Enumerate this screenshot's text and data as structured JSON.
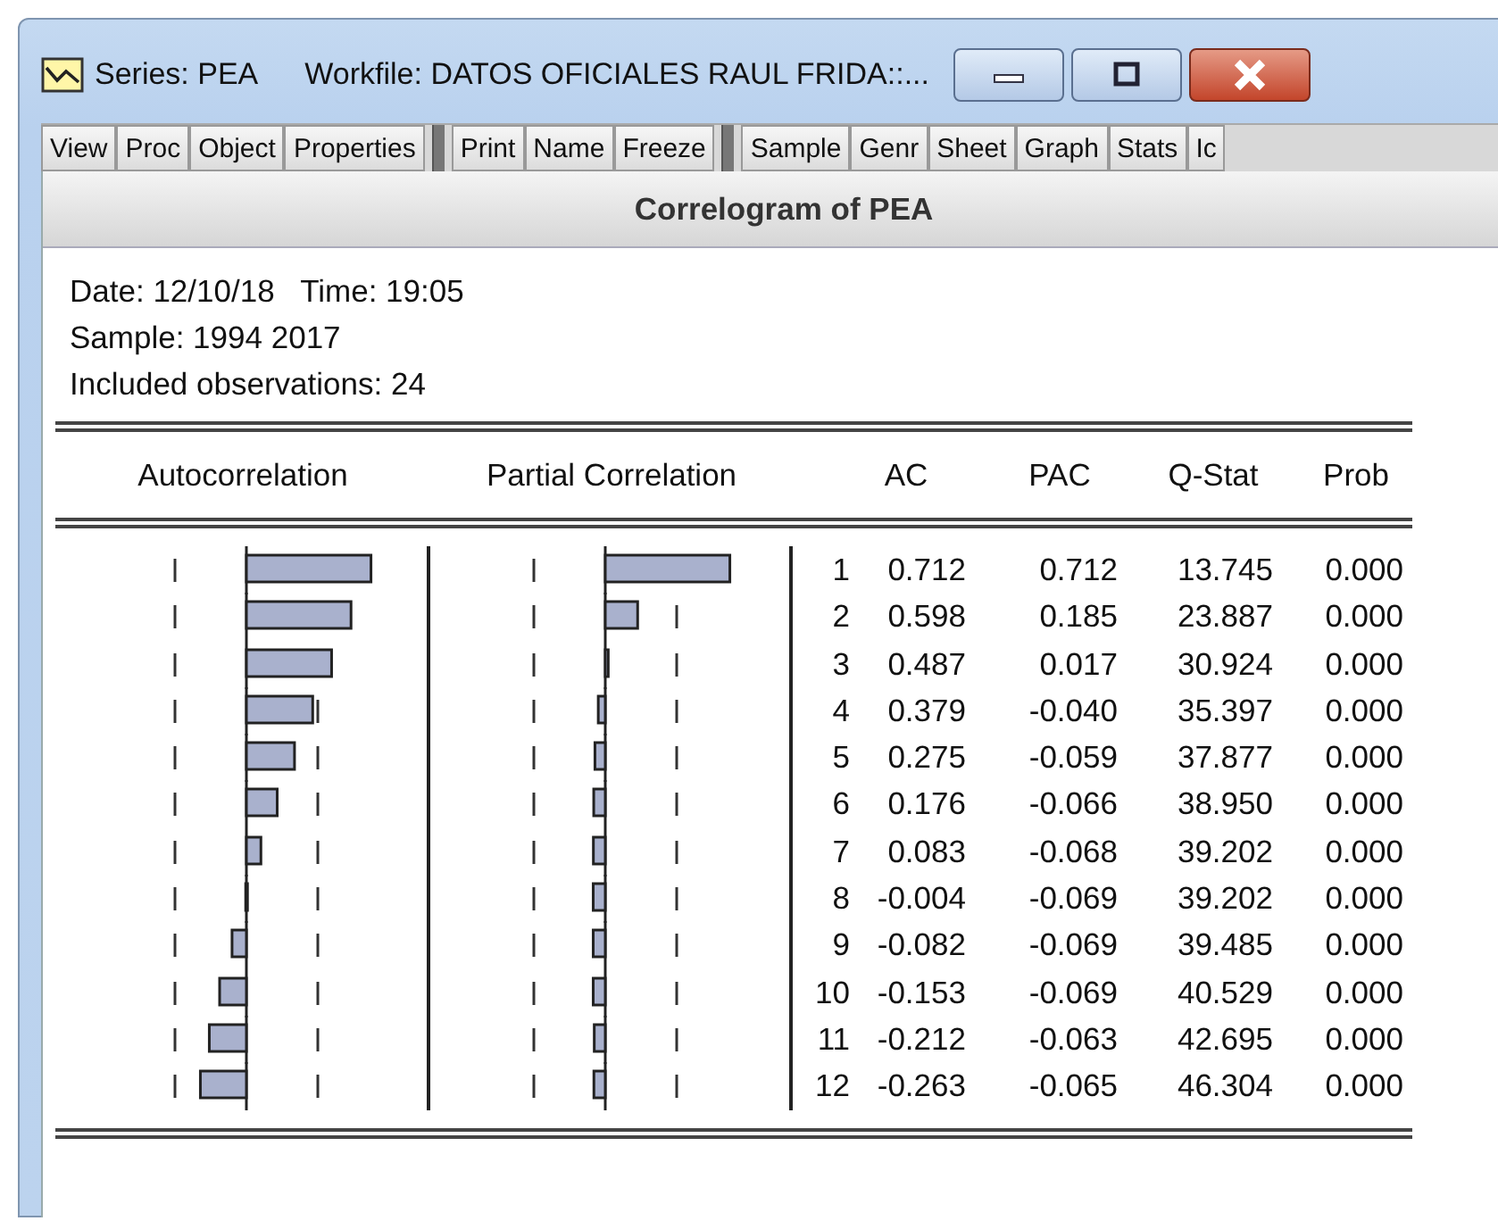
{
  "window": {
    "series_title": "Series: PEA",
    "workfile_title": "Workfile: DATOS OFICIALES RAUL FRIDA::..."
  },
  "toolbar": [
    [
      "View",
      "Proc",
      "Object",
      "Properties"
    ],
    [
      "Print",
      "Name",
      "Freeze"
    ],
    [
      "Sample",
      "Genr",
      "Sheet",
      "Graph",
      "Stats",
      "Ic"
    ]
  ],
  "view_title": "Correlogram of PEA",
  "info": [
    "Date: 12/10/18   Time: 19:05",
    "Sample: 1994 2017",
    "Included observations: 24"
  ],
  "columns": [
    "Autocorrelation",
    "Partial Correlation",
    "AC",
    "PAC",
    "Q-Stat",
    "Prob"
  ],
  "rows": [
    {
      "lag": "1",
      "ac": "0.712",
      "pac": "0.712",
      "q_stat": "13.745",
      "prob": "0.000"
    },
    {
      "lag": "2",
      "ac": "0.598",
      "pac": "0.185",
      "q_stat": "23.887",
      "prob": "0.000"
    },
    {
      "lag": "3",
      "ac": "0.487",
      "pac": "0.017",
      "q_stat": "30.924",
      "prob": "0.000"
    },
    {
      "lag": "4",
      "ac": "0.379",
      "pac": "-0.040",
      "q_stat": "35.397",
      "prob": "0.000"
    },
    {
      "lag": "5",
      "ac": "0.275",
      "pac": "-0.059",
      "q_stat": "37.877",
      "prob": "0.000"
    },
    {
      "lag": "6",
      "ac": "0.176",
      "pac": "-0.066",
      "q_stat": "38.950",
      "prob": "0.000"
    },
    {
      "lag": "7",
      "ac": "0.083",
      "pac": "-0.068",
      "q_stat": "39.202",
      "prob": "0.000"
    },
    {
      "lag": "8",
      "ac": "-0.004",
      "pac": "-0.069",
      "q_stat": "39.202",
      "prob": "0.000"
    },
    {
      "lag": "9",
      "ac": "-0.082",
      "pac": "-0.069",
      "q_stat": "39.485",
      "prob": "0.000"
    },
    {
      "lag": "10",
      "ac": "-0.153",
      "pac": "-0.069",
      "q_stat": "40.529",
      "prob": "0.000"
    },
    {
      "lag": "11",
      "ac": "-0.212",
      "pac": "-0.063",
      "q_stat": "42.695",
      "prob": "0.000"
    },
    {
      "lag": "12",
      "ac": "-0.263",
      "pac": "-0.065",
      "q_stat": "46.304",
      "prob": "0.000"
    }
  ]
}
